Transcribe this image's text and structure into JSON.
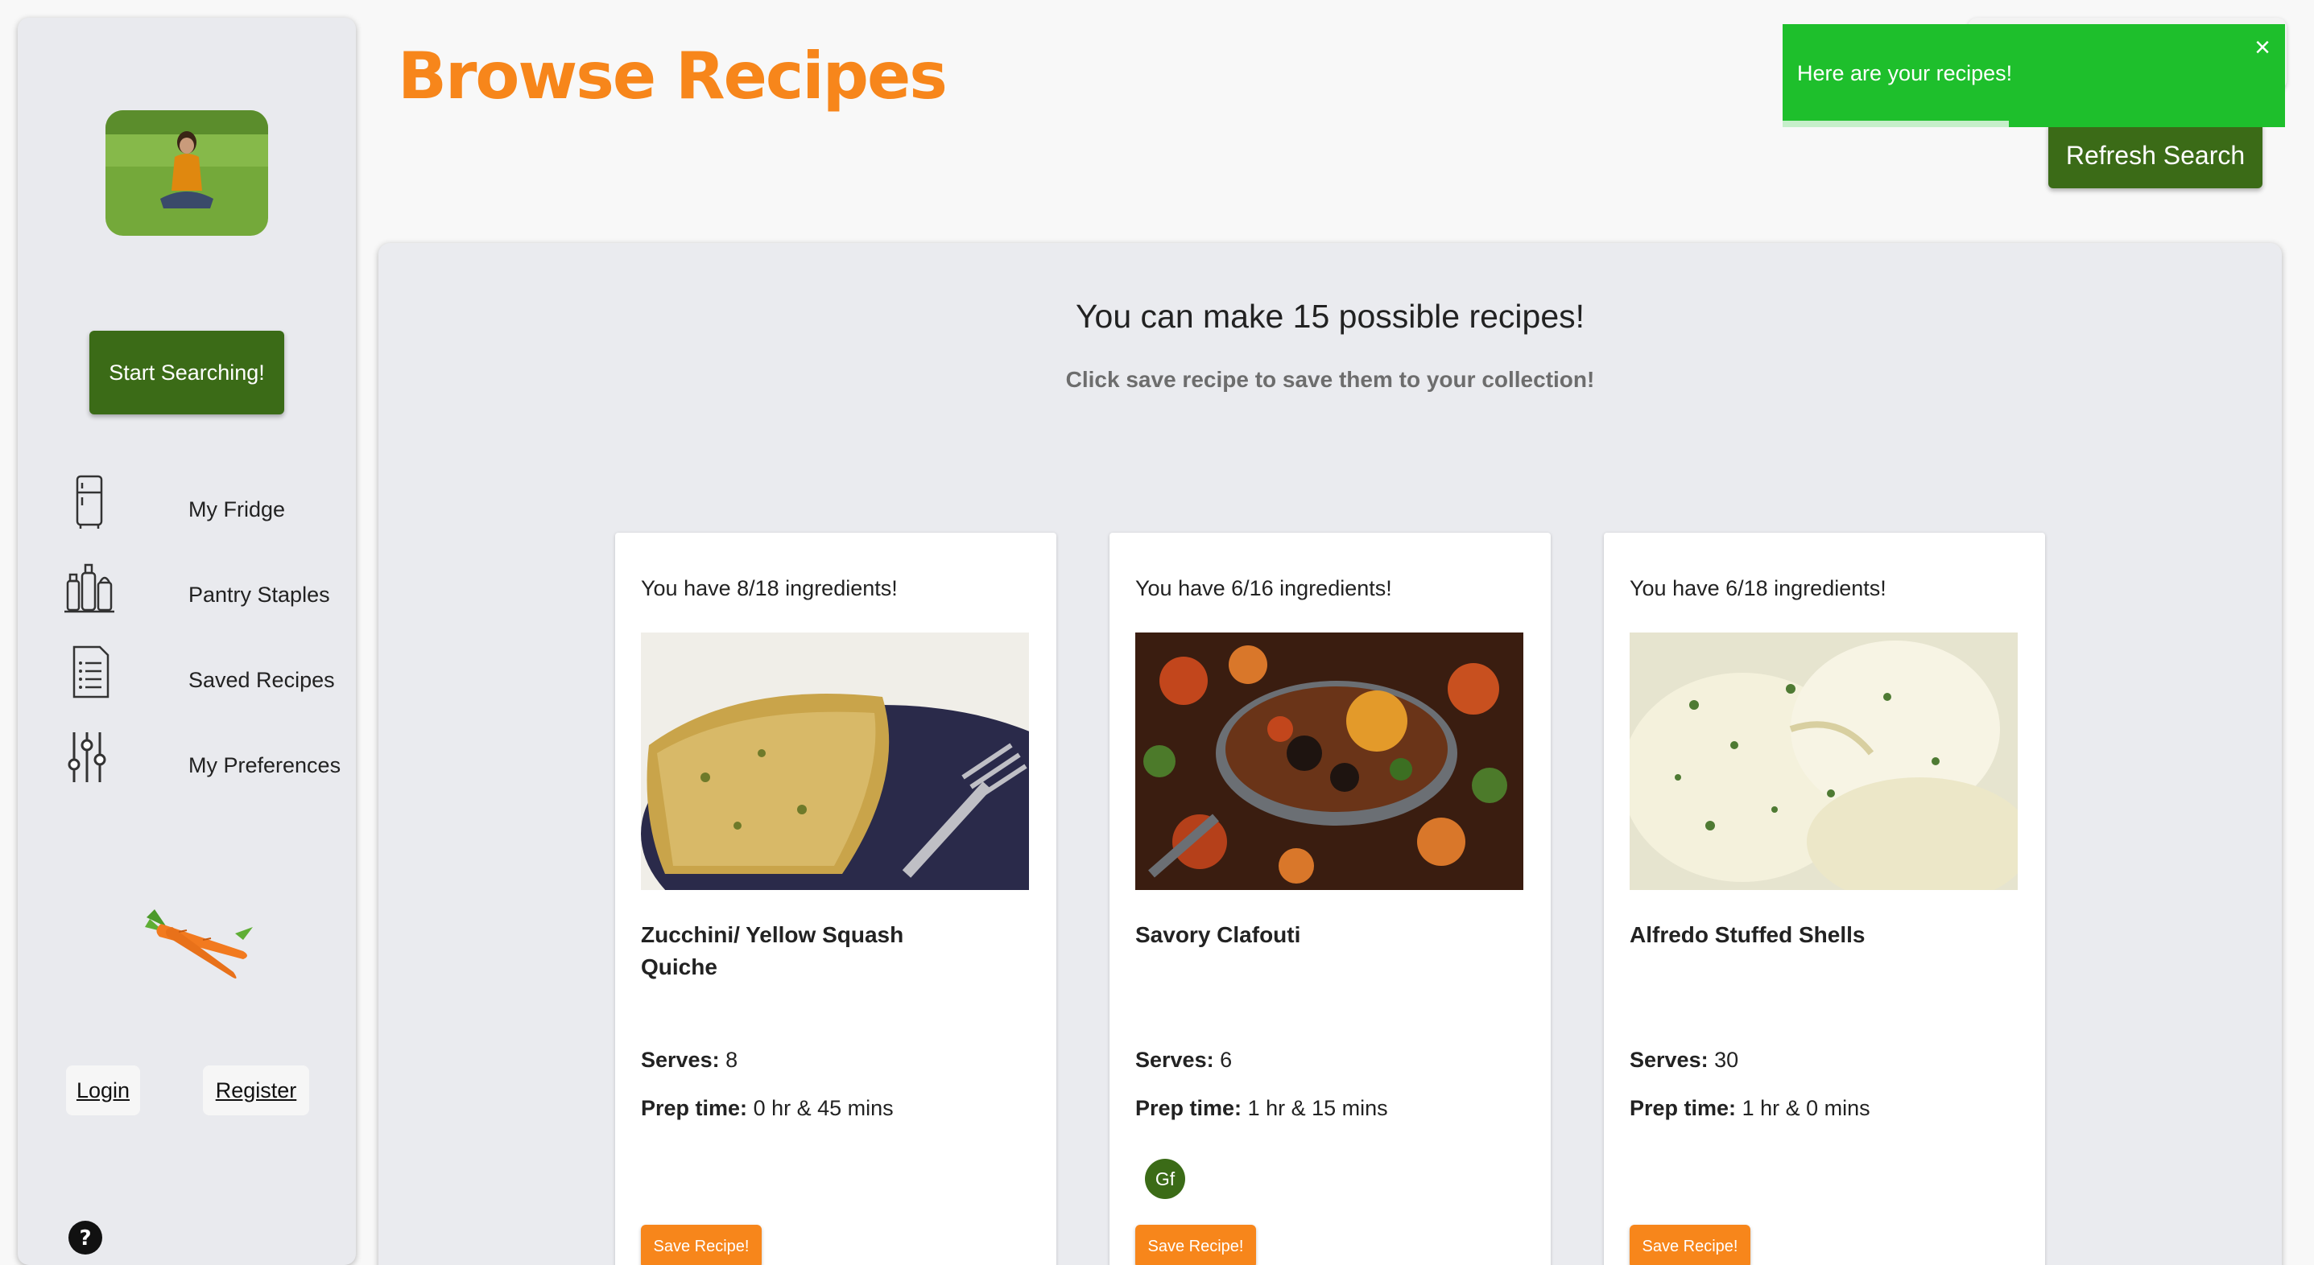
{
  "sidebar": {
    "start_button": "Start Searching!",
    "nav": [
      {
        "label": "My Fridge",
        "icon": "fridge-icon"
      },
      {
        "label": "Pantry Staples",
        "icon": "pantry-icon"
      },
      {
        "label": "Saved Recipes",
        "icon": "document-list-icon"
      },
      {
        "label": "My Preferences",
        "icon": "sliders-icon"
      }
    ],
    "login": "Login",
    "register": "Register"
  },
  "header": {
    "title": "Browse Recipes",
    "refresh_button": "Refresh Search"
  },
  "toast": {
    "message": "Here are your recipes!",
    "close": "×",
    "progress_fraction": 0.45
  },
  "main": {
    "headline": "You can make 15 possible recipes!",
    "subhead": "Click save recipe to save them to your collection!"
  },
  "recipes": [
    {
      "have": "You have 8/18 ingredients!",
      "title": "Zucchini/ Yellow Squash Quiche",
      "serves_label": "Serves:",
      "serves": "8",
      "prep_label": "Prep time:",
      "prep": "0 hr & 45 mins",
      "badges": [],
      "save": "Save Recipe!"
    },
    {
      "have": "You have 6/16 ingredients!",
      "title": "Savory Clafouti",
      "serves_label": "Serves:",
      "serves": "6",
      "prep_label": "Prep time:",
      "prep": "1 hr & 15 mins",
      "badges": [
        "Gf"
      ],
      "save": "Save Recipe!"
    },
    {
      "have": "You have 6/18 ingredients!",
      "title": "Alfredo Stuffed Shells",
      "serves_label": "Serves:",
      "serves": "30",
      "prep_label": "Prep time:",
      "prep": "1 hr & 0 mins",
      "badges": [],
      "save": "Save Recipe!"
    }
  ],
  "colors": {
    "brand_orange": "#f7861b",
    "brand_green": "#3b6b17",
    "toast_green": "#1ebf2c"
  }
}
